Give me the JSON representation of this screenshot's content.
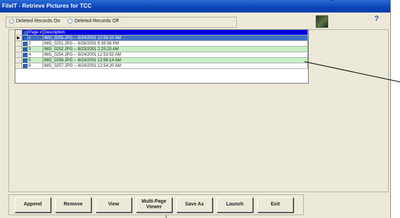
{
  "window": {
    "title": "FileIT - Retrieve Pictures for TCC"
  },
  "options": {
    "deleted_on": "Deleted Records On",
    "deleted_off": "Deleted Records Off"
  },
  "help_label": "?",
  "grid": {
    "headers": {
      "page": "Page #",
      "description": "Description"
    },
    "rows": [
      {
        "page": "1",
        "description": "IMG_0255.JPG -- 8/24/2001 12:56:10 AM"
      },
      {
        "page": "2",
        "description": "IMG_0251.JPG -- 8/26/2001 9:35:56 PM"
      },
      {
        "page": "3",
        "description": "IMG_0252.JPG -- 8/23/2001 2:25:20 AM"
      },
      {
        "page": "4",
        "description": "IMG_0254.JPG -- 8/24/2001 12:53:52 AM"
      },
      {
        "page": "5",
        "description": "IMG_0256.JPG -- 8/24/2001 12:56:14 AM"
      },
      {
        "page": "6",
        "description": "IMG_0257.JPG -- 8/24/2001 12:54:20 AM"
      }
    ]
  },
  "buttons": {
    "append": "Append",
    "remove": "Remove",
    "view": "View",
    "multi_page_viewer": "Multi-Page Viewer",
    "save_as": "Save As",
    "launch": "Launch",
    "exit": "Exit"
  },
  "colors": {
    "title_bar": "#0a44b8",
    "header_row": "#0000e0",
    "selected_row": "#3f6fc4",
    "alt_row": "#c7f0c5"
  },
  "icons": {
    "row_pointer": "right-triangle",
    "image_button": "picture-icon",
    "help": "question-mark"
  }
}
